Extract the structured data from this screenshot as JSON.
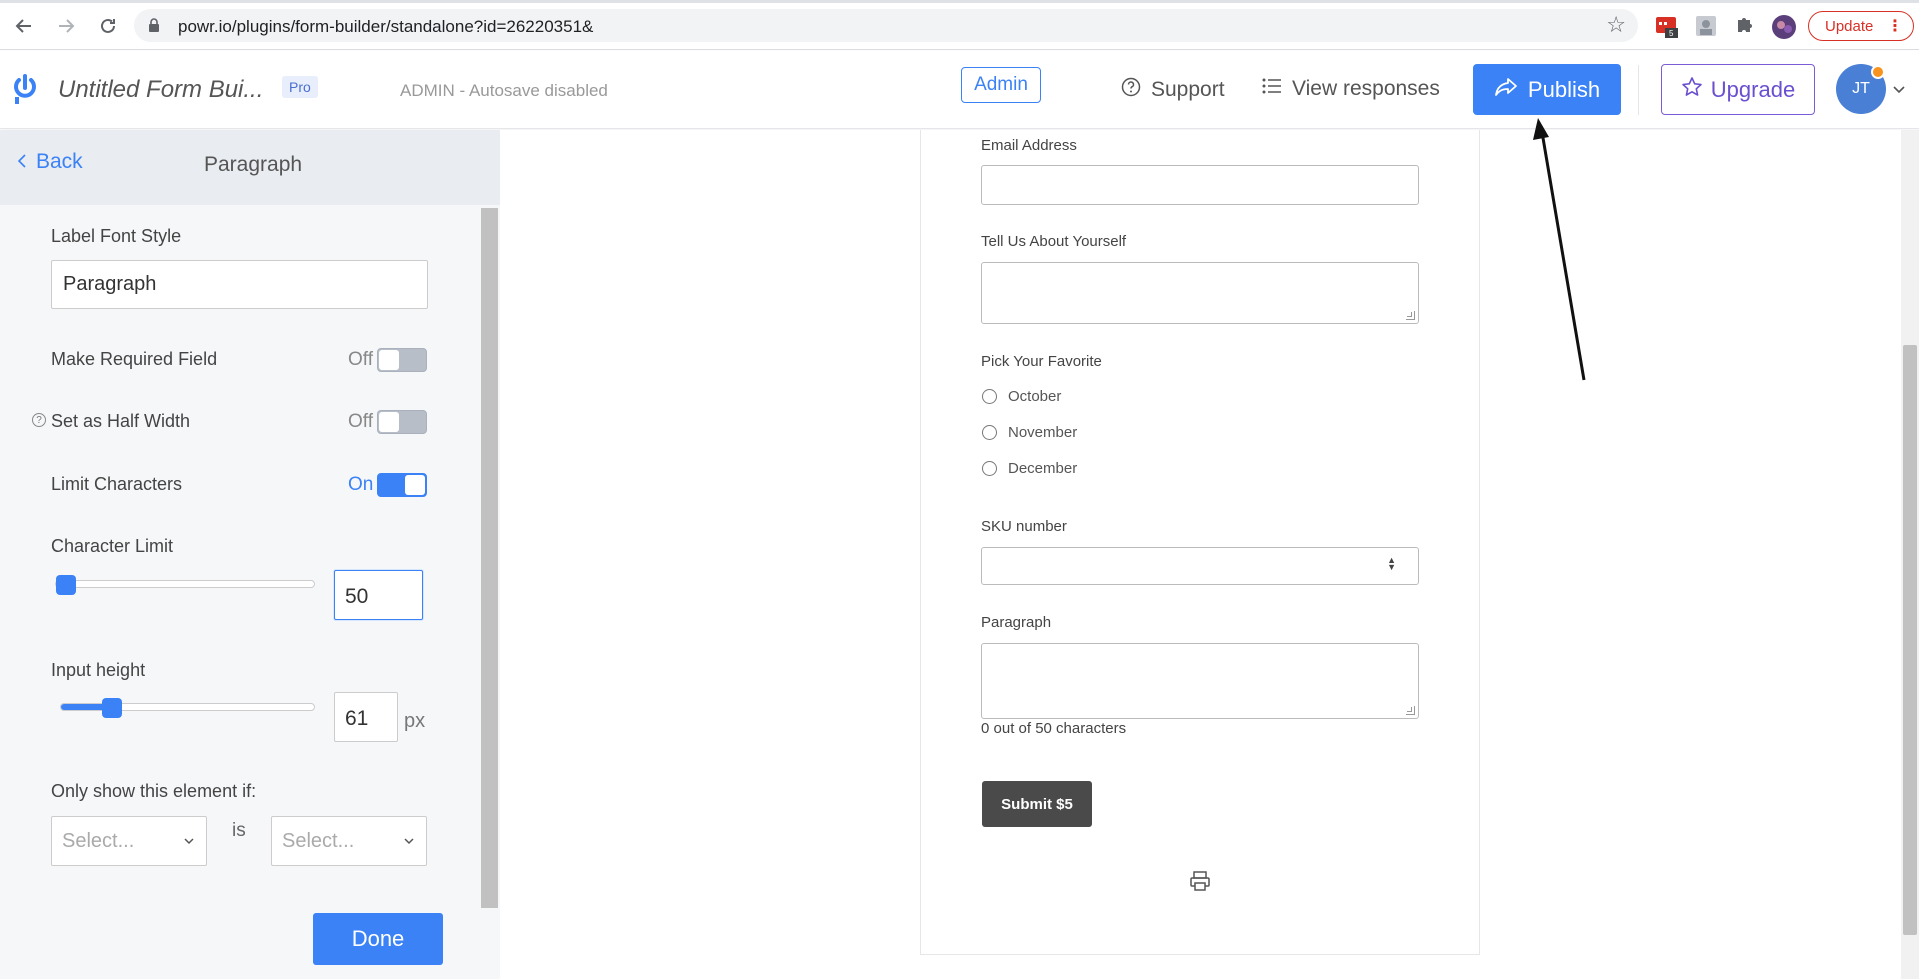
{
  "browser": {
    "url": "powr.io/plugins/form-builder/standalone?id=26220351&",
    "extension_badge": "5",
    "update_label": "Update"
  },
  "header": {
    "app_title": "Untitled Form Bui...",
    "pro_badge": "Pro",
    "autosave_status": "ADMIN - Autosave disabled",
    "admin_label": "Admin",
    "support_label": "Support",
    "view_responses_label": "View responses",
    "publish_label": "Publish",
    "upgrade_label": "Upgrade",
    "avatar_initials": "JT"
  },
  "panel": {
    "back_label": "Back",
    "title": "Paragraph",
    "label_font_style": {
      "label": "Label Font Style",
      "value": "Paragraph"
    },
    "required_field": {
      "label": "Make Required Field",
      "state": "Off"
    },
    "half_width": {
      "label": "Set as Half Width",
      "state": "Off"
    },
    "limit_characters": {
      "label": "Limit Characters",
      "state": "On"
    },
    "character_limit": {
      "label": "Character Limit",
      "value": "50"
    },
    "input_height": {
      "label": "Input height",
      "value": "61",
      "unit": "px"
    },
    "condition": {
      "label": "Only show this element if:",
      "select_placeholder_1": "Select...",
      "operator": "is",
      "select_placeholder_2": "Select..."
    },
    "done_label": "Done"
  },
  "form": {
    "email_label": "Email Address",
    "about_label": "Tell Us About Yourself",
    "favorite_label": "Pick Your Favorite",
    "favorite_options": [
      "October",
      "November",
      "December"
    ],
    "sku_label": "SKU number",
    "paragraph_label": "Paragraph",
    "char_count": "0 out of 50 characters",
    "submit_label": "Submit $5"
  },
  "colors": {
    "accent": "#3b82f6",
    "upgrade": "#6a4fd0",
    "submit": "#4a4a4a",
    "update": "#d93025"
  }
}
